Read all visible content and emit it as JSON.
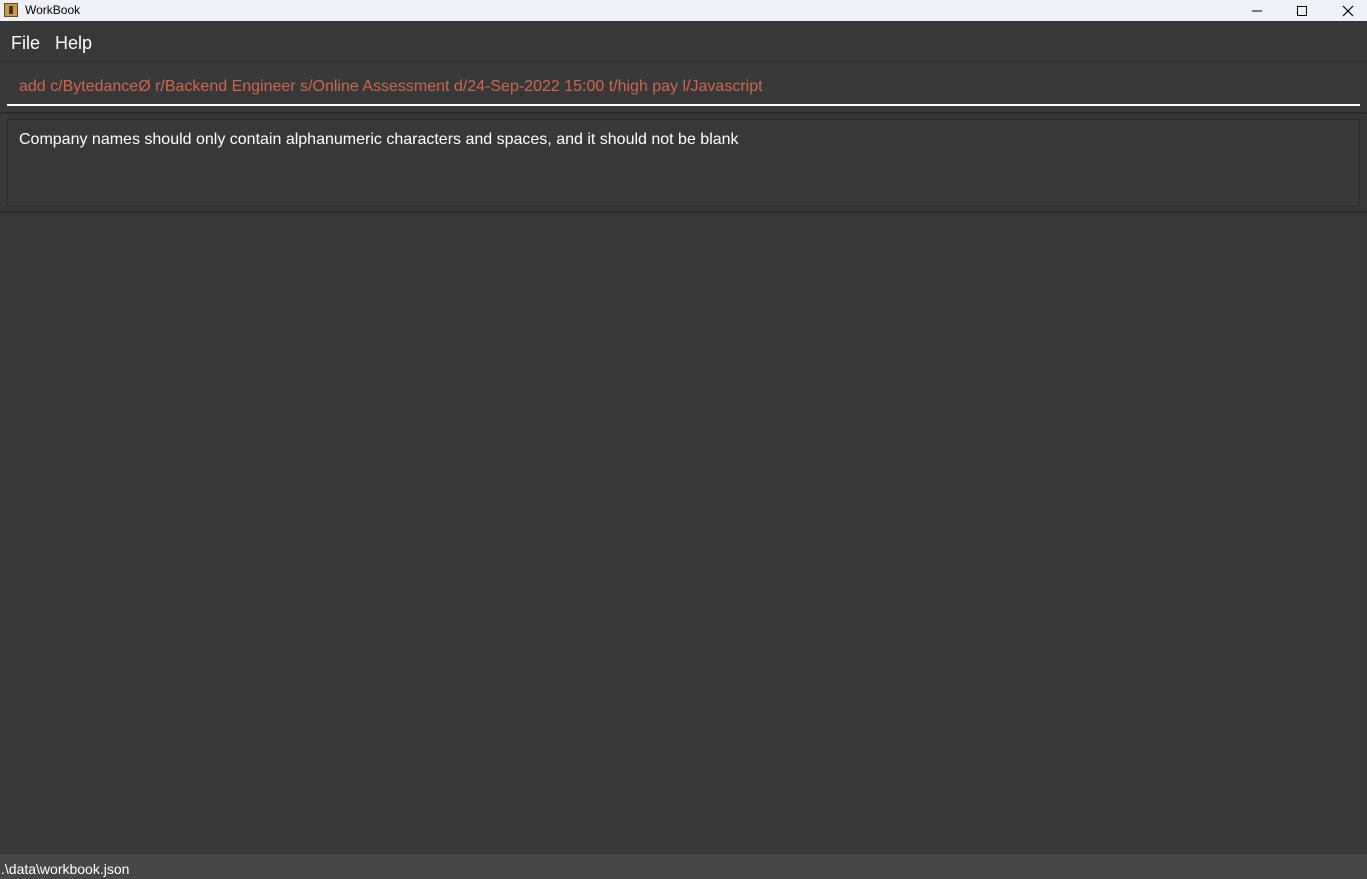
{
  "window": {
    "title": "WorkBook",
    "controls": [
      "minimize-icon",
      "maximize-icon",
      "close-icon"
    ]
  },
  "menu": {
    "items": [
      "File",
      "Help"
    ]
  },
  "command_box": {
    "value": "add c/BytedanceØ r/Backend Engineer s/Online Assessment d/24-Sep-2022 15:00 t/high pay l/Javascript",
    "text_color": "#d06651"
  },
  "result_display": {
    "message": "Company names should only contain alphanumeric characters and spaces, and it should not be blank"
  },
  "status_bar": {
    "path": ".\\data\\workbook.json"
  },
  "colors": {
    "background": "#383838",
    "titlebar": "#eef1f8",
    "statusbar": "#474747",
    "error_text": "#d06651"
  }
}
